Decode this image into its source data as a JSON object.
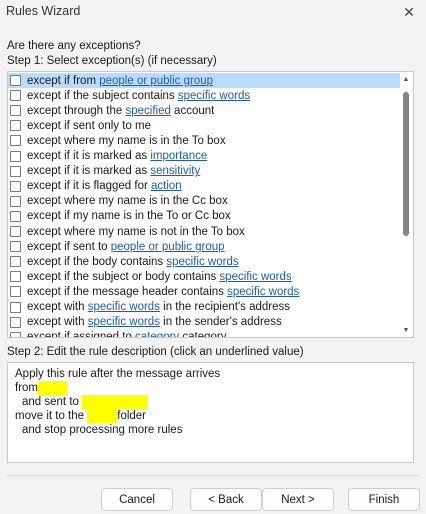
{
  "window": {
    "title": "Rules Wizard"
  },
  "prompt": "Are there any exceptions?",
  "step1": {
    "label": "Step 1: Select exception(s) (if necessary)",
    "items": [
      {
        "parts": [
          {
            "t": "except if from "
          },
          {
            "t": "people or public group",
            "link": true
          }
        ],
        "selected": true
      },
      {
        "parts": [
          {
            "t": "except if the subject contains "
          },
          {
            "t": "specific words",
            "link": true
          }
        ]
      },
      {
        "parts": [
          {
            "t": "except through the "
          },
          {
            "t": "specified",
            "link": true
          },
          {
            "t": " account"
          }
        ]
      },
      {
        "parts": [
          {
            "t": "except if sent only to me"
          }
        ]
      },
      {
        "parts": [
          {
            "t": "except where my name is in the To box"
          }
        ]
      },
      {
        "parts": [
          {
            "t": "except if it is marked as "
          },
          {
            "t": "importance",
            "link": true
          }
        ]
      },
      {
        "parts": [
          {
            "t": "except if it is marked as "
          },
          {
            "t": "sensitivity",
            "link": true
          }
        ]
      },
      {
        "parts": [
          {
            "t": "except if it is flagged for "
          },
          {
            "t": "action",
            "link": true
          }
        ]
      },
      {
        "parts": [
          {
            "t": "except where my name is in the Cc box"
          }
        ]
      },
      {
        "parts": [
          {
            "t": "except if my name is in the To or Cc box"
          }
        ]
      },
      {
        "parts": [
          {
            "t": "except where my name is not in the To box"
          }
        ]
      },
      {
        "parts": [
          {
            "t": "except if sent to "
          },
          {
            "t": "people or public group",
            "link": true
          }
        ]
      },
      {
        "parts": [
          {
            "t": "except if the body contains "
          },
          {
            "t": "specific words",
            "link": true
          }
        ]
      },
      {
        "parts": [
          {
            "t": "except if the subject or body contains "
          },
          {
            "t": "specific words",
            "link": true
          }
        ]
      },
      {
        "parts": [
          {
            "t": "except if the message header contains "
          },
          {
            "t": "specific words",
            "link": true
          }
        ]
      },
      {
        "parts": [
          {
            "t": "except with "
          },
          {
            "t": "specific words",
            "link": true
          },
          {
            "t": " in the recipient's address"
          }
        ]
      },
      {
        "parts": [
          {
            "t": "except with "
          },
          {
            "t": "specific words",
            "link": true
          },
          {
            "t": " in the sender's address"
          }
        ]
      },
      {
        "parts": [
          {
            "t": "except if assigned to "
          },
          {
            "t": "category",
            "link": true
          },
          {
            "t": " category"
          }
        ]
      }
    ]
  },
  "step2": {
    "label": "Step 2: Edit the rule description (click an underlined value)",
    "lines": {
      "apply": "Apply this rule after the message arrives",
      "from": "from",
      "sent_to": "and sent to",
      "move_prefix": "move it to the",
      "move_suffix": "folder",
      "stop": "and stop processing more rules"
    }
  },
  "buttons": {
    "cancel": "Cancel",
    "back": "< Back",
    "next": "Next >",
    "finish": "Finish"
  },
  "colors": {
    "link": "#1f5ca8",
    "selection": "#b8dcff",
    "highlight": "#ffff00"
  }
}
